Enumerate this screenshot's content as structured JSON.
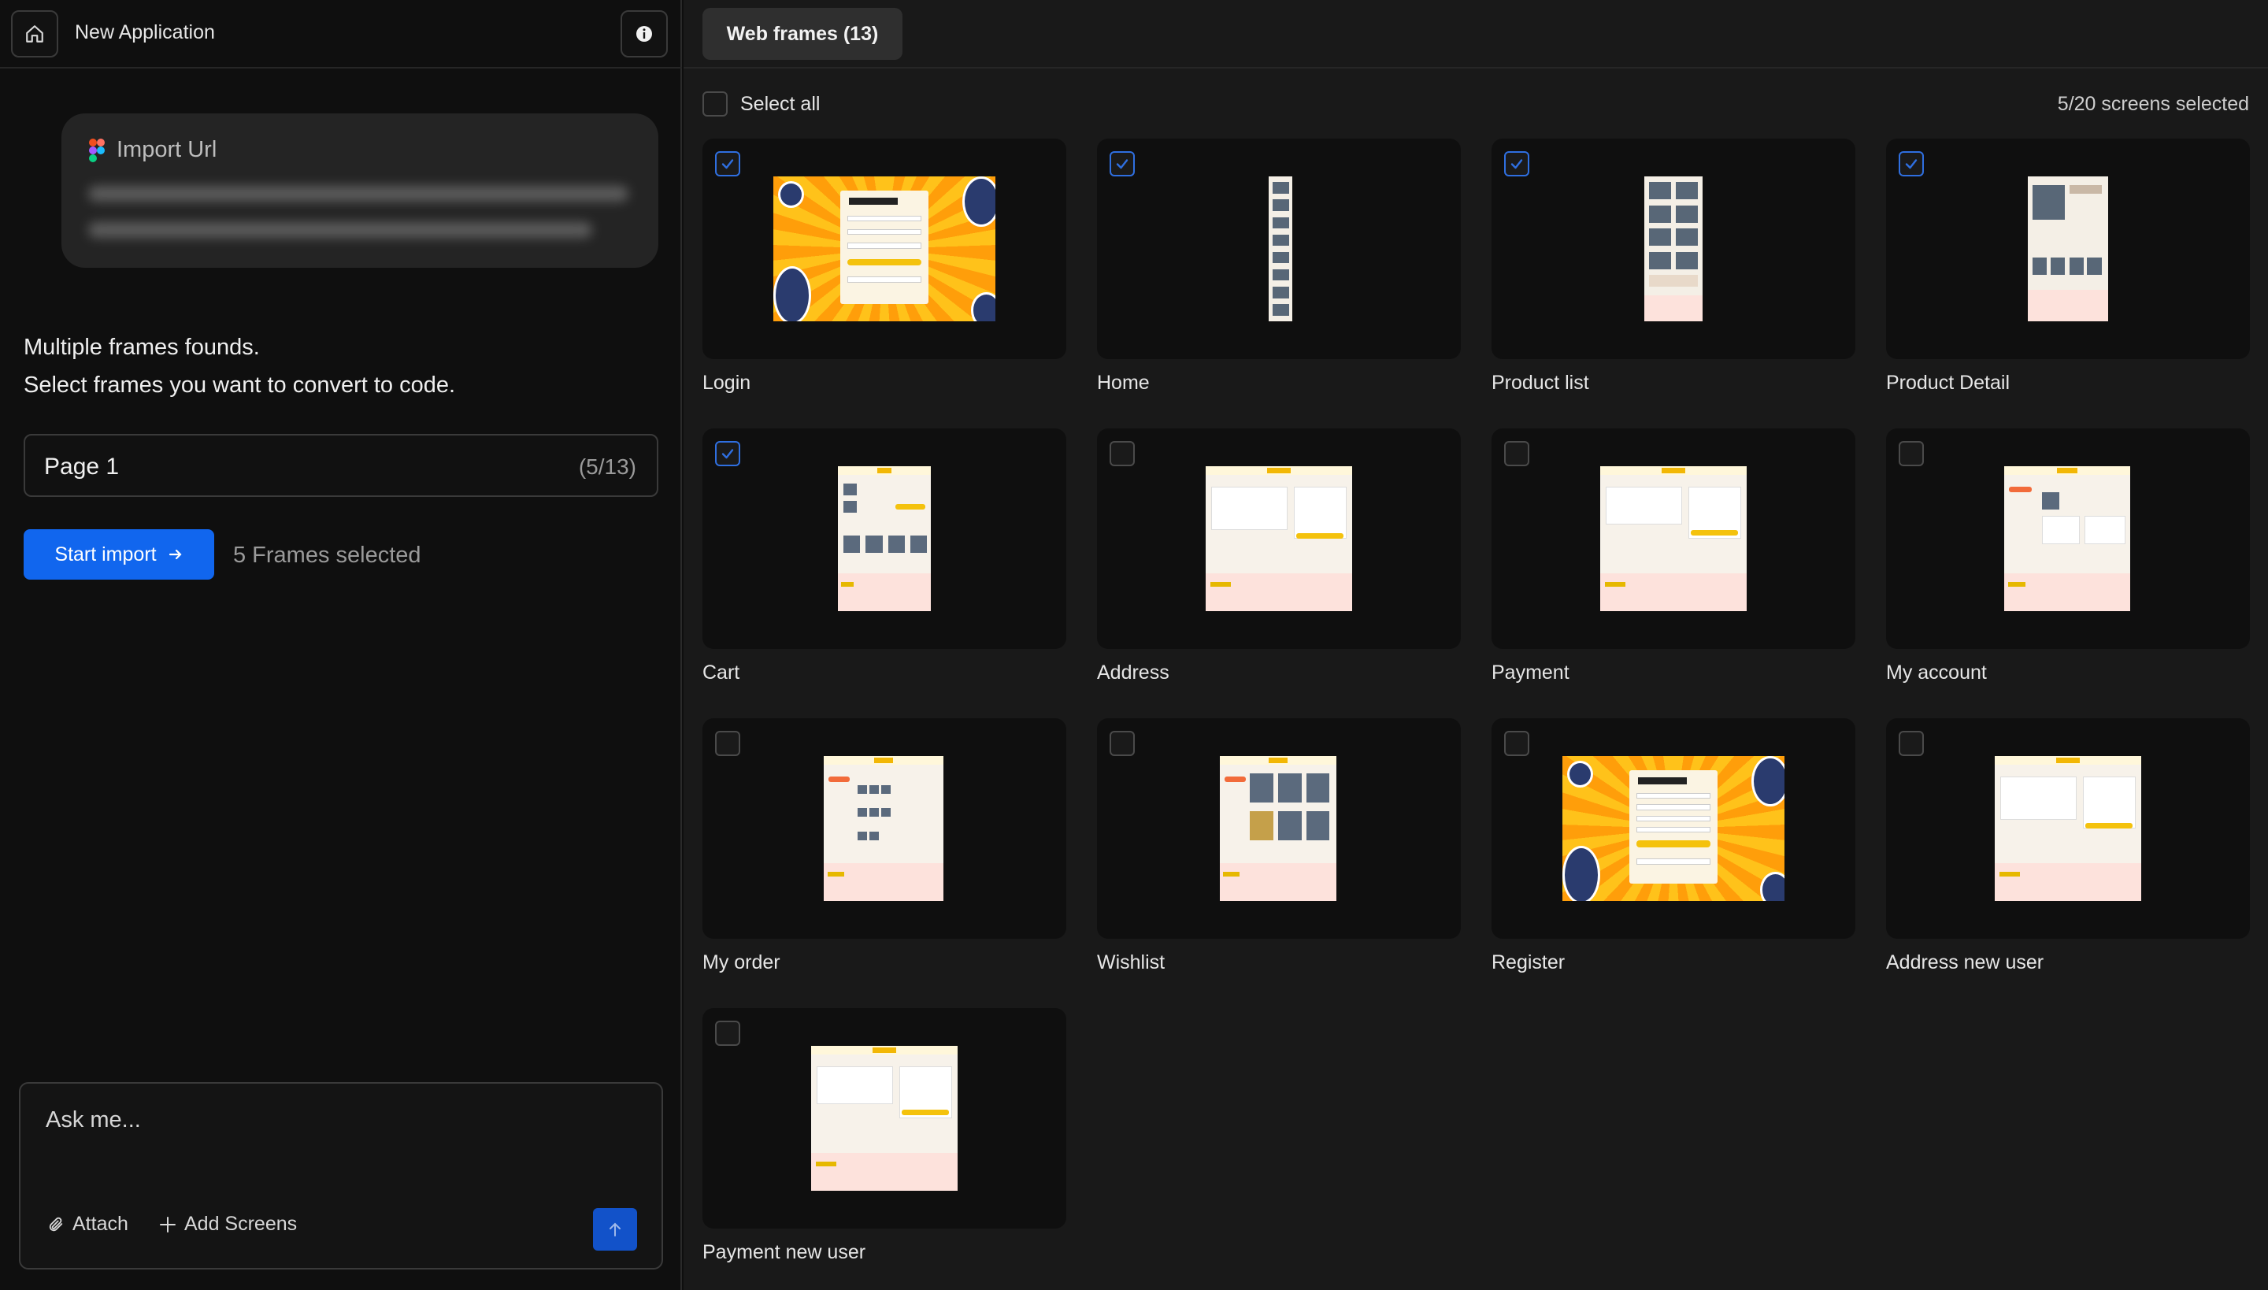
{
  "app": {
    "title": "New Application"
  },
  "import": {
    "label": "Import Url"
  },
  "messages": {
    "line1": "Multiple frames founds.",
    "line2": "Select frames you want to convert to code."
  },
  "page_select": {
    "name": "Page 1",
    "count": "(5/13)"
  },
  "start_import": {
    "label": "Start import"
  },
  "frames_selected": "5 Frames selected",
  "chat": {
    "placeholder": "Ask me...",
    "attach_label": "Attach",
    "add_screens_label": "Add Screens"
  },
  "tabs": [
    {
      "label": "Web frames (13)"
    }
  ],
  "select_all_label": "Select all",
  "screens_selected": "5/20 screens selected",
  "colors": {
    "accent": "#1166ee",
    "check": "#2f6fe0",
    "figma": [
      "#f24e1e",
      "#a259ff",
      "#1abcfe",
      "#0acf83"
    ]
  },
  "frames": [
    {
      "label": "Login",
      "checked": true
    },
    {
      "label": "Home",
      "checked": true
    },
    {
      "label": "Product list",
      "checked": true
    },
    {
      "label": "Product Detail",
      "checked": true
    },
    {
      "label": "Cart",
      "checked": true
    },
    {
      "label": "Address",
      "checked": false
    },
    {
      "label": "Payment",
      "checked": false
    },
    {
      "label": "My account",
      "checked": false
    },
    {
      "label": "My order",
      "checked": false
    },
    {
      "label": "Wishlist",
      "checked": false
    },
    {
      "label": "Register",
      "checked": false
    },
    {
      "label": "Address new user",
      "checked": false
    },
    {
      "label": "Payment new user",
      "checked": false
    }
  ]
}
